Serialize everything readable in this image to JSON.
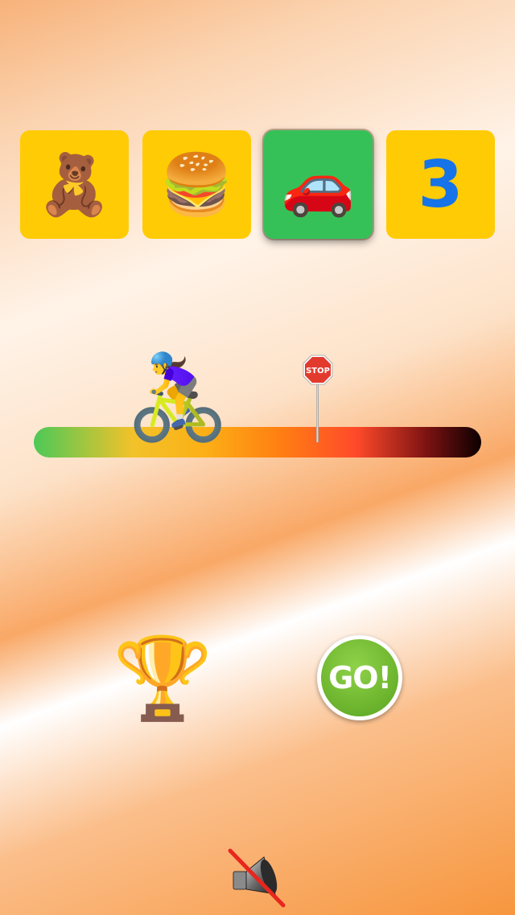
{
  "tiles": [
    {
      "icon": "teddy-bear-icon",
      "glyph": "🧸",
      "selected": false
    },
    {
      "icon": "hamburger-icon",
      "glyph": "🍔",
      "selected": false
    },
    {
      "icon": "car-icon",
      "glyph": "🚗",
      "selected": true
    },
    {
      "number": "3",
      "selected": false
    }
  ],
  "track": {
    "rider_icon": "woman-cyclist-icon",
    "rider_glyph": "🚴‍♀️",
    "stop_sign_label": "STOP"
  },
  "trophy": {
    "icon": "trophy-icon",
    "glyph": "🏆"
  },
  "go_button": {
    "label": "GO!"
  },
  "sound": {
    "icon": "muted-speaker-icon",
    "muted": true
  },
  "colors": {
    "tile": "#ffcb05",
    "tile_selected": "#36c158",
    "number": "#1673e8",
    "go_button": "#6fb72f"
  }
}
